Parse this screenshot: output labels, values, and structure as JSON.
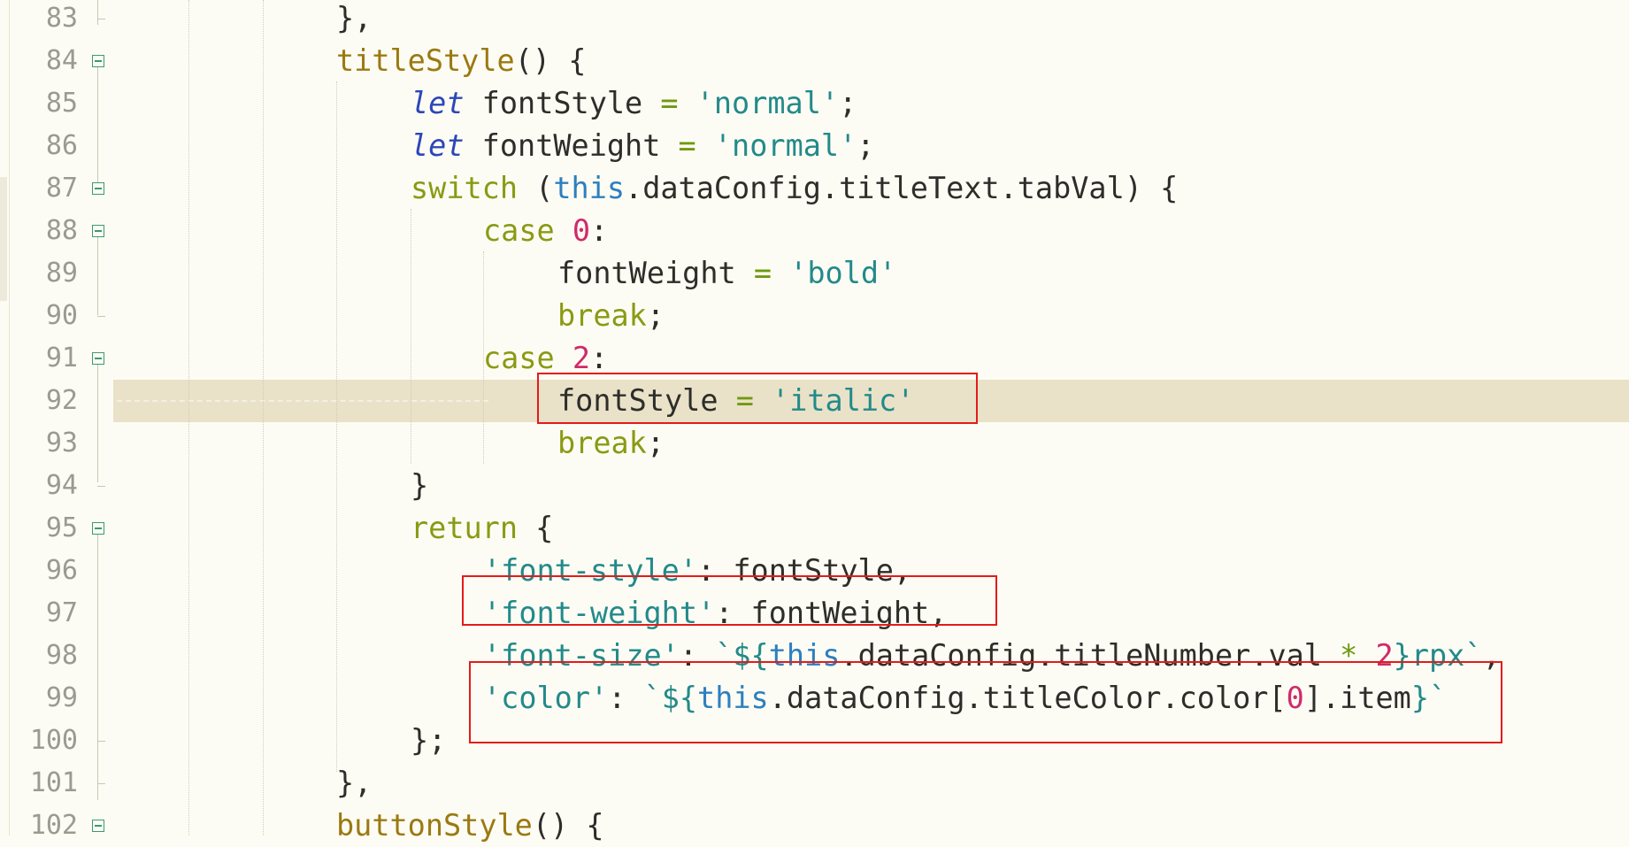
{
  "editor": {
    "line_numbers": [
      "83",
      "84",
      "85",
      "86",
      "87",
      "88",
      "89",
      "90",
      "91",
      "92",
      "93",
      "94",
      "95",
      "96",
      "97",
      "98",
      "99",
      "100",
      "101",
      "102"
    ],
    "current_line": "92",
    "colors": {
      "background": "#fdfcf4",
      "current_line": "#e9e2c8",
      "highlight_box": "#e31b1b",
      "keyword": "#8a9a14",
      "string": "#238a8a",
      "number": "#cf2b6a",
      "function_name": "#9a7a11"
    },
    "icons": {
      "fold": "fold-collapse-icon"
    }
  },
  "code": {
    "l83": {
      "a": "},"
    },
    "l84": {
      "fn": "titleStyle",
      "b": "() {"
    },
    "l85": {
      "kw": "let",
      "a": " fontStyle ",
      "op": "=",
      "sp": " ",
      "str": "'normal'",
      "b": ";"
    },
    "l86": {
      "kw": "let",
      "a": " fontWeight ",
      "op": "=",
      "sp": " ",
      "str": "'normal'",
      "b": ";"
    },
    "l87": {
      "kw": "switch",
      "a": " (",
      "ths": "this",
      "b": ".dataConfig.titleText.tabVal) {"
    },
    "l88": {
      "kw": "case",
      "sp": " ",
      "num": "0",
      "b": ":"
    },
    "l89": {
      "a": "fontWeight ",
      "op": "=",
      "sp": " ",
      "str": "'bold'"
    },
    "l90": {
      "kw": "break",
      "b": ";"
    },
    "l91": {
      "kw": "case",
      "sp": " ",
      "num": "2",
      "b": ":"
    },
    "l92": {
      "a": "fontStyle ",
      "op": "=",
      "sp": " ",
      "str": "'italic'"
    },
    "l93": {
      "kw": "break",
      "b": ";"
    },
    "l94": {
      "a": "}"
    },
    "l95": {
      "kw": "return",
      "b": " {"
    },
    "l96": {
      "str": "'font-style'",
      "b": ": fontStyle,"
    },
    "l97": {
      "str": "'font-weight'",
      "b": ": fontWeight,"
    },
    "l98": {
      "str": "'font-size'",
      "b1": ": ",
      "tpl1": "`${",
      "ths": "this",
      "b2": ".dataConfig.titleNumber.val ",
      "op": "*",
      "sp": " ",
      "num": "2",
      "tpl2": "}rpx`",
      "b3": ","
    },
    "l99": {
      "str": "'color'",
      "b1": ": ",
      "tpl1": "`${",
      "ths": "this",
      "b2": ".dataConfig.titleColor.color[",
      "num": "0",
      "b3": "].item",
      "tpl2": "}`"
    },
    "l100": {
      "a": "};"
    },
    "l101": {
      "a": "},"
    },
    "l102": {
      "fn": "buttonStyle",
      "b": "() {"
    }
  }
}
